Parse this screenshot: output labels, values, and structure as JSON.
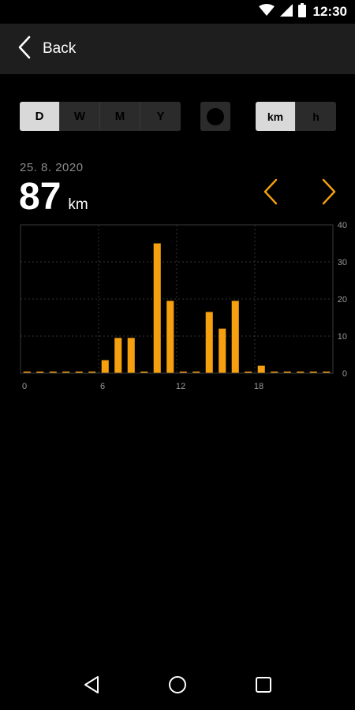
{
  "status_bar": {
    "time": "12:30"
  },
  "app_bar": {
    "back_label": "Back"
  },
  "period_selector": {
    "options": [
      "D",
      "W",
      "M",
      "Y"
    ],
    "selected": "D"
  },
  "unit_selector": {
    "options": [
      "km",
      "h"
    ],
    "selected": "km"
  },
  "summary": {
    "date": "25. 8. 2020",
    "value": "87",
    "unit": "km"
  },
  "colors": {
    "accent": "#f5a00f",
    "background": "#000000",
    "panel": "#2b2b2b",
    "app_bar": "#1e1e1e",
    "active_segment": "#d9d9d9"
  },
  "chart_data": {
    "type": "bar",
    "title": "",
    "xlabel": "",
    "ylabel": "",
    "x": [
      0,
      1,
      2,
      3,
      4,
      5,
      6,
      7,
      8,
      9,
      10,
      11,
      12,
      13,
      14,
      15,
      16,
      17,
      18,
      19,
      20,
      21,
      22,
      23
    ],
    "values": [
      0,
      0,
      0,
      0,
      0,
      0,
      3.5,
      9.5,
      9.5,
      0,
      35,
      19.5,
      0,
      0,
      16.5,
      12,
      19.5,
      0,
      2,
      0,
      0,
      0,
      0,
      0
    ],
    "x_ticks": [
      "0",
      "6",
      "12",
      "18"
    ],
    "y_ticks": [
      "0",
      "10",
      "20",
      "30",
      "40"
    ],
    "xlim": [
      0,
      24
    ],
    "ylim": [
      0,
      40
    ],
    "y_axis_side": "right",
    "grid": true,
    "legend": "none"
  }
}
